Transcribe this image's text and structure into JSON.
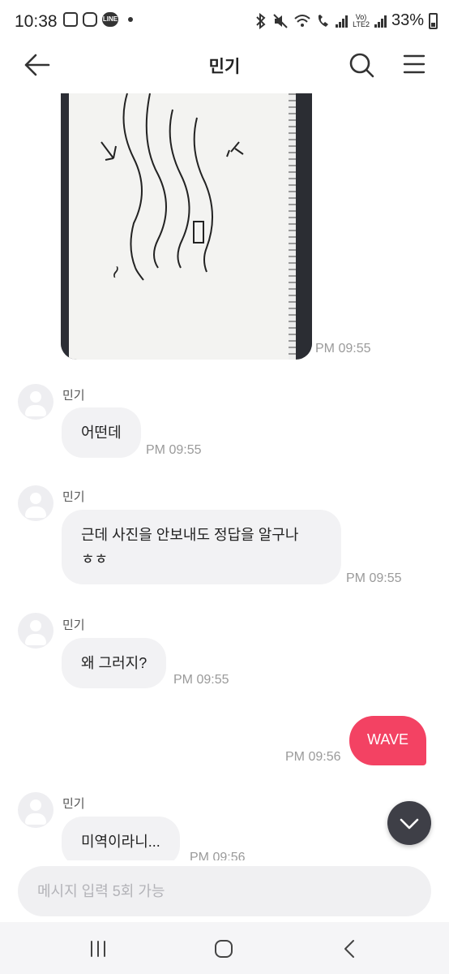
{
  "status_bar": {
    "time": "10:38",
    "battery": "33%",
    "network": "LTE2",
    "line_icon": "LINE"
  },
  "header": {
    "title": "민기"
  },
  "messages": [
    {
      "type": "image",
      "sender": "me",
      "time": "PM 09:55"
    },
    {
      "type": "text",
      "sender": "민기",
      "lines": [
        "어떤데"
      ],
      "time": "PM 09:55"
    },
    {
      "type": "text",
      "sender": "민기",
      "lines": [
        "근데 사진을 안보내도 정답을 알구나",
        "ㅎㅎ"
      ],
      "time": "PM 09:55"
    },
    {
      "type": "text",
      "sender": "민기",
      "lines": [
        "왜 그러지?"
      ],
      "time": "PM 09:55"
    },
    {
      "type": "text",
      "sender": "me",
      "lines": [
        "WAVE"
      ],
      "time": "PM 09:56"
    },
    {
      "type": "text",
      "sender": "민기",
      "lines": [
        "미역이라니..."
      ],
      "time": "PM 09:56"
    }
  ],
  "input": {
    "placeholder": "메시지 입력 5회 가능"
  },
  "colors": {
    "accent": "#f34263",
    "bubble_other": "#f2f2f4",
    "scroll_button": "#3e3f47"
  },
  "icons": [
    "back-arrow-icon",
    "search-icon",
    "menu-icon",
    "chevron-down-icon",
    "recent-apps-icon",
    "home-icon",
    "back-nav-icon"
  ]
}
